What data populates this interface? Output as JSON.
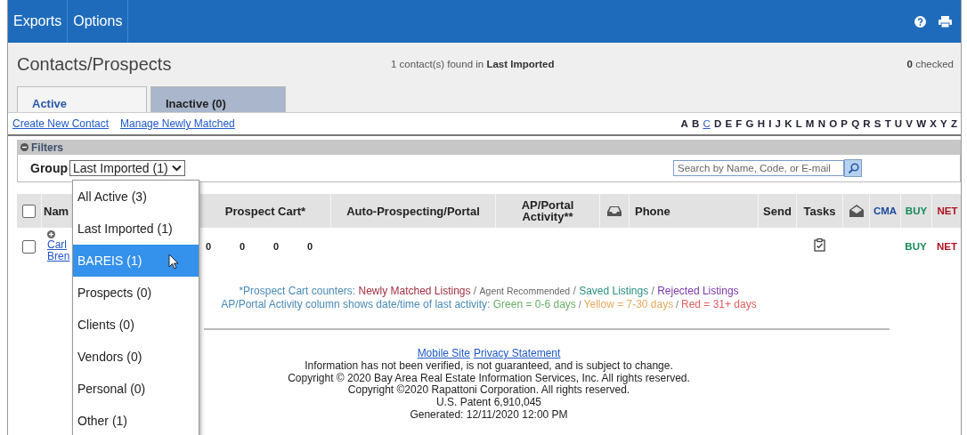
{
  "menu": [
    {
      "label": "Exports"
    },
    {
      "label": "Options"
    }
  ],
  "title": "Contacts/Prospects",
  "summary": {
    "text": "1 contact(s) found in ",
    "group": "Last Imported"
  },
  "checked_count": {
    "count": "0",
    "label": " checked"
  },
  "tabs": [
    {
      "label": "Active",
      "selected": true
    },
    {
      "label": "Inactive (0)",
      "selected": false
    }
  ],
  "links": [
    "Create New Contact",
    "Manage Newly Matched"
  ],
  "letters": [
    {
      "label": "A",
      "selected": false
    },
    {
      "label": "B",
      "selected": false
    },
    {
      "label": "C",
      "selected": true
    },
    {
      "label": "D",
      "selected": false
    },
    {
      "label": "E",
      "selected": false
    },
    {
      "label": "F",
      "selected": false
    },
    {
      "label": "G",
      "selected": false
    },
    {
      "label": "H",
      "selected": false
    },
    {
      "label": "I",
      "selected": false
    },
    {
      "label": "J",
      "selected": false
    },
    {
      "label": "K",
      "selected": false
    },
    {
      "label": "L",
      "selected": false
    },
    {
      "label": "M",
      "selected": false
    },
    {
      "label": "N",
      "selected": false
    },
    {
      "label": "O",
      "selected": false
    },
    {
      "label": "P",
      "selected": false
    },
    {
      "label": "Q",
      "selected": false
    },
    {
      "label": "R",
      "selected": false
    },
    {
      "label": "S",
      "selected": false
    },
    {
      "label": "T",
      "selected": false
    },
    {
      "label": "U",
      "selected": false
    },
    {
      "label": "V",
      "selected": false
    },
    {
      "label": "W",
      "selected": false
    },
    {
      "label": "X",
      "selected": false
    },
    {
      "label": "Y",
      "selected": false
    },
    {
      "label": "Z",
      "selected": false
    }
  ],
  "filters": {
    "title": "Filters",
    "expanded": true,
    "group_label": "Group",
    "group_value": "Last Imported (1)",
    "search": {
      "placeholder": "Search by Name, Code, or E-mail"
    }
  },
  "group_dropdown": [
    {
      "label": "All Active (3)",
      "selected": false
    },
    {
      "label": "Last Imported (1)",
      "selected": false
    },
    {
      "label": "BAREIS (1)",
      "selected": true
    },
    {
      "label": "Prospects (0)",
      "selected": false
    },
    {
      "label": "Clients (0)",
      "selected": false
    },
    {
      "label": "Vendors (0)",
      "selected": false
    },
    {
      "label": "Personal (0)",
      "selected": false
    },
    {
      "label": "Other (1)",
      "selected": false
    }
  ],
  "table": {
    "select_all_checked": false,
    "columns": [
      {
        "kind": "text",
        "label": "Nam"
      },
      {
        "kind": "text",
        "label": "Prospect Cart*"
      },
      {
        "kind": "text",
        "label": "Auto-Prospecting/Portal"
      },
      {
        "kind": "text",
        "label": "AP/Portal Activity**"
      },
      {
        "kind": "inbox"
      },
      {
        "kind": "text_left",
        "label": "Phone"
      },
      {
        "kind": "text",
        "label": "Send"
      },
      {
        "kind": "text",
        "label": "Tasks"
      },
      {
        "kind": "envelope"
      },
      {
        "kind": "text",
        "label": "CMA",
        "color": "#1a4a9a"
      },
      {
        "kind": "text",
        "label": "BUY",
        "color": "#138a5a"
      },
      {
        "kind": "text",
        "label": "NET",
        "color": "#b01020"
      }
    ],
    "rows": [
      {
        "checked": false,
        "name_lines": [
          "Carl",
          "Bren"
        ],
        "counts": [
          "0",
          "0",
          "0",
          "0"
        ],
        "has_task": true,
        "buy": "BUY",
        "net": "NET"
      }
    ]
  },
  "notes": [
    [
      {
        "text": "*Prospect Cart counters: ",
        "color": "#4a8ab8"
      },
      {
        "text": "Newly Matched Listings",
        "color": "#a03040"
      },
      {
        "text": " / "
      },
      {
        "text": "Agent Recommended",
        "color": "#666666",
        "small": true
      },
      {
        "text": " / "
      },
      {
        "text": "Saved Listings",
        "color": "#2a9080"
      },
      {
        "text": " / "
      },
      {
        "text": "Rejected Listings",
        "color": "#7a3aa8"
      }
    ],
    [
      {
        "text": "AP/Portal Activity column shows date/time of last activity: ",
        "color": "#4a8ab8"
      },
      {
        "text": "Green = 0-6 days",
        "color": "#6ab06a"
      },
      {
        "text": " / ",
        "small": true
      },
      {
        "text": "Yellow = 7-30 days",
        "color": "#e8a860"
      },
      {
        "text": " / ",
        "small": true
      },
      {
        "text": "Red = 31+ days",
        "color": "#e06060"
      }
    ]
  ],
  "footer": {
    "links": [
      "Mobile Site",
      "Privacy Statement"
    ],
    "lines": [
      "Information has not been verified, is not guaranteed, and is subject to change.",
      "Copyright © 2020 Bay Area Real Estate Information Services, Inc. All rights reserved.",
      "Copyright ©2020 Rapattoni Corporation. All rights reserved.",
      "U.S. Patent 6,910,045",
      "Generated: 12/11/2020 12:00 PM"
    ]
  }
}
